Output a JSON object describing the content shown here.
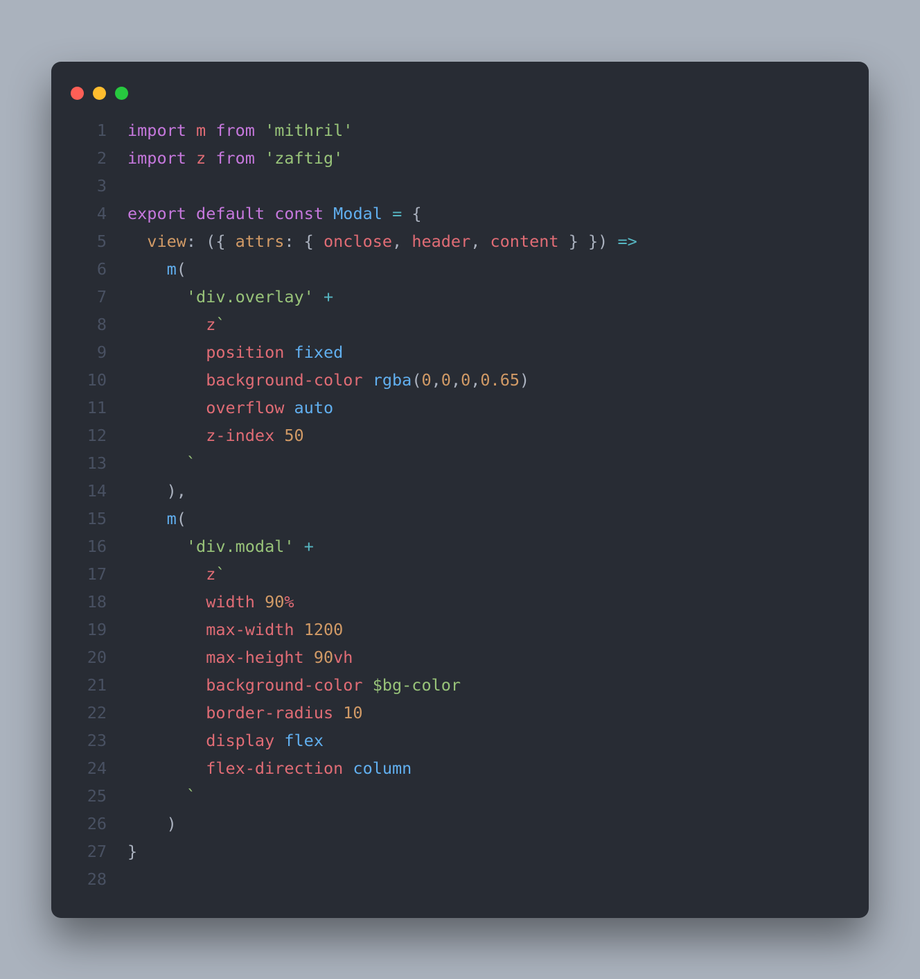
{
  "colors": {
    "bg": "#282c34",
    "red": "#ff5f56",
    "yellow": "#ffbd2e",
    "green": "#27c93f"
  },
  "lines": [
    {
      "n": 1,
      "tokens": [
        [
          "kw",
          "import"
        ],
        [
          "pun",
          " "
        ],
        [
          "id",
          "m"
        ],
        [
          "pun",
          " "
        ],
        [
          "kw",
          "from"
        ],
        [
          "pun",
          " "
        ],
        [
          "str",
          "'mithril'"
        ]
      ]
    },
    {
      "n": 2,
      "tokens": [
        [
          "kw",
          "import"
        ],
        [
          "pun",
          " "
        ],
        [
          "id",
          "z"
        ],
        [
          "pun",
          " "
        ],
        [
          "kw",
          "from"
        ],
        [
          "pun",
          " "
        ],
        [
          "str",
          "'zaftig'"
        ]
      ]
    },
    {
      "n": 3,
      "tokens": []
    },
    {
      "n": 4,
      "tokens": [
        [
          "kw",
          "export"
        ],
        [
          "pun",
          " "
        ],
        [
          "kw",
          "default"
        ],
        [
          "pun",
          " "
        ],
        [
          "kw",
          "const"
        ],
        [
          "pun",
          " "
        ],
        [
          "fn",
          "Modal"
        ],
        [
          "pun",
          " "
        ],
        [
          "op",
          "="
        ],
        [
          "pun",
          " "
        ],
        [
          "pun",
          "{"
        ]
      ]
    },
    {
      "n": 5,
      "tokens": [
        [
          "pun",
          "  "
        ],
        [
          "attr",
          "view"
        ],
        [
          "pun",
          ": ({ "
        ],
        [
          "attr",
          "attrs"
        ],
        [
          "pun",
          ": { "
        ],
        [
          "id",
          "onclose"
        ],
        [
          "pun",
          ", "
        ],
        [
          "id",
          "header"
        ],
        [
          "pun",
          ", "
        ],
        [
          "id",
          "content"
        ],
        [
          "pun",
          " } }) "
        ],
        [
          "op",
          "=>"
        ]
      ]
    },
    {
      "n": 6,
      "tokens": [
        [
          "pun",
          "    "
        ],
        [
          "fn",
          "m"
        ],
        [
          "pun",
          "("
        ]
      ]
    },
    {
      "n": 7,
      "tokens": [
        [
          "pun",
          "      "
        ],
        [
          "str",
          "'div.overlay'"
        ],
        [
          "pun",
          " "
        ],
        [
          "op",
          "+"
        ]
      ]
    },
    {
      "n": 8,
      "tokens": [
        [
          "pun",
          "        "
        ],
        [
          "id",
          "z"
        ],
        [
          "str",
          "`"
        ]
      ]
    },
    {
      "n": 9,
      "tokens": [
        [
          "pun",
          "        "
        ],
        [
          "id",
          "position"
        ],
        [
          "pun",
          " "
        ],
        [
          "fn",
          "fixed"
        ]
      ]
    },
    {
      "n": 10,
      "tokens": [
        [
          "pun",
          "        "
        ],
        [
          "id",
          "background-color"
        ],
        [
          "pun",
          " "
        ],
        [
          "fn",
          "rgba"
        ],
        [
          "pun",
          "("
        ],
        [
          "num",
          "0"
        ],
        [
          "pun",
          ","
        ],
        [
          "num",
          "0"
        ],
        [
          "pun",
          ","
        ],
        [
          "num",
          "0"
        ],
        [
          "pun",
          ","
        ],
        [
          "num",
          "0.65"
        ],
        [
          "pun",
          ")"
        ]
      ]
    },
    {
      "n": 11,
      "tokens": [
        [
          "pun",
          "        "
        ],
        [
          "id",
          "overflow"
        ],
        [
          "pun",
          " "
        ],
        [
          "fn",
          "auto"
        ]
      ]
    },
    {
      "n": 12,
      "tokens": [
        [
          "pun",
          "        "
        ],
        [
          "id",
          "z-index"
        ],
        [
          "pun",
          " "
        ],
        [
          "num",
          "50"
        ]
      ]
    },
    {
      "n": 13,
      "tokens": [
        [
          "pun",
          "      "
        ],
        [
          "str",
          "`"
        ]
      ]
    },
    {
      "n": 14,
      "tokens": [
        [
          "pun",
          "    ),"
        ]
      ]
    },
    {
      "n": 15,
      "tokens": [
        [
          "pun",
          "    "
        ],
        [
          "fn",
          "m"
        ],
        [
          "pun",
          "("
        ]
      ]
    },
    {
      "n": 16,
      "tokens": [
        [
          "pun",
          "      "
        ],
        [
          "str",
          "'div.modal'"
        ],
        [
          "pun",
          " "
        ],
        [
          "op",
          "+"
        ]
      ]
    },
    {
      "n": 17,
      "tokens": [
        [
          "pun",
          "        "
        ],
        [
          "id",
          "z"
        ],
        [
          "str",
          "`"
        ]
      ]
    },
    {
      "n": 18,
      "tokens": [
        [
          "pun",
          "        "
        ],
        [
          "id",
          "width"
        ],
        [
          "pun",
          " "
        ],
        [
          "num",
          "90"
        ],
        [
          "id",
          "%"
        ]
      ]
    },
    {
      "n": 19,
      "tokens": [
        [
          "pun",
          "        "
        ],
        [
          "id",
          "max-width"
        ],
        [
          "pun",
          " "
        ],
        [
          "num",
          "1200"
        ]
      ]
    },
    {
      "n": 20,
      "tokens": [
        [
          "pun",
          "        "
        ],
        [
          "id",
          "max-height"
        ],
        [
          "pun",
          " "
        ],
        [
          "num",
          "90"
        ],
        [
          "id",
          "vh"
        ]
      ]
    },
    {
      "n": 21,
      "tokens": [
        [
          "pun",
          "        "
        ],
        [
          "id",
          "background-color"
        ],
        [
          "pun",
          " "
        ],
        [
          "str",
          "$bg-color"
        ]
      ]
    },
    {
      "n": 22,
      "tokens": [
        [
          "pun",
          "        "
        ],
        [
          "id",
          "border-radius"
        ],
        [
          "pun",
          " "
        ],
        [
          "num",
          "10"
        ]
      ]
    },
    {
      "n": 23,
      "tokens": [
        [
          "pun",
          "        "
        ],
        [
          "id",
          "display"
        ],
        [
          "pun",
          " "
        ],
        [
          "fn",
          "flex"
        ]
      ]
    },
    {
      "n": 24,
      "tokens": [
        [
          "pun",
          "        "
        ],
        [
          "id",
          "flex-direction"
        ],
        [
          "pun",
          " "
        ],
        [
          "fn",
          "column"
        ]
      ]
    },
    {
      "n": 25,
      "tokens": [
        [
          "pun",
          "      "
        ],
        [
          "str",
          "`"
        ]
      ]
    },
    {
      "n": 26,
      "tokens": [
        [
          "pun",
          "    )"
        ]
      ]
    },
    {
      "n": 27,
      "tokens": [
        [
          "pun",
          "}"
        ]
      ]
    },
    {
      "n": 28,
      "tokens": []
    }
  ]
}
